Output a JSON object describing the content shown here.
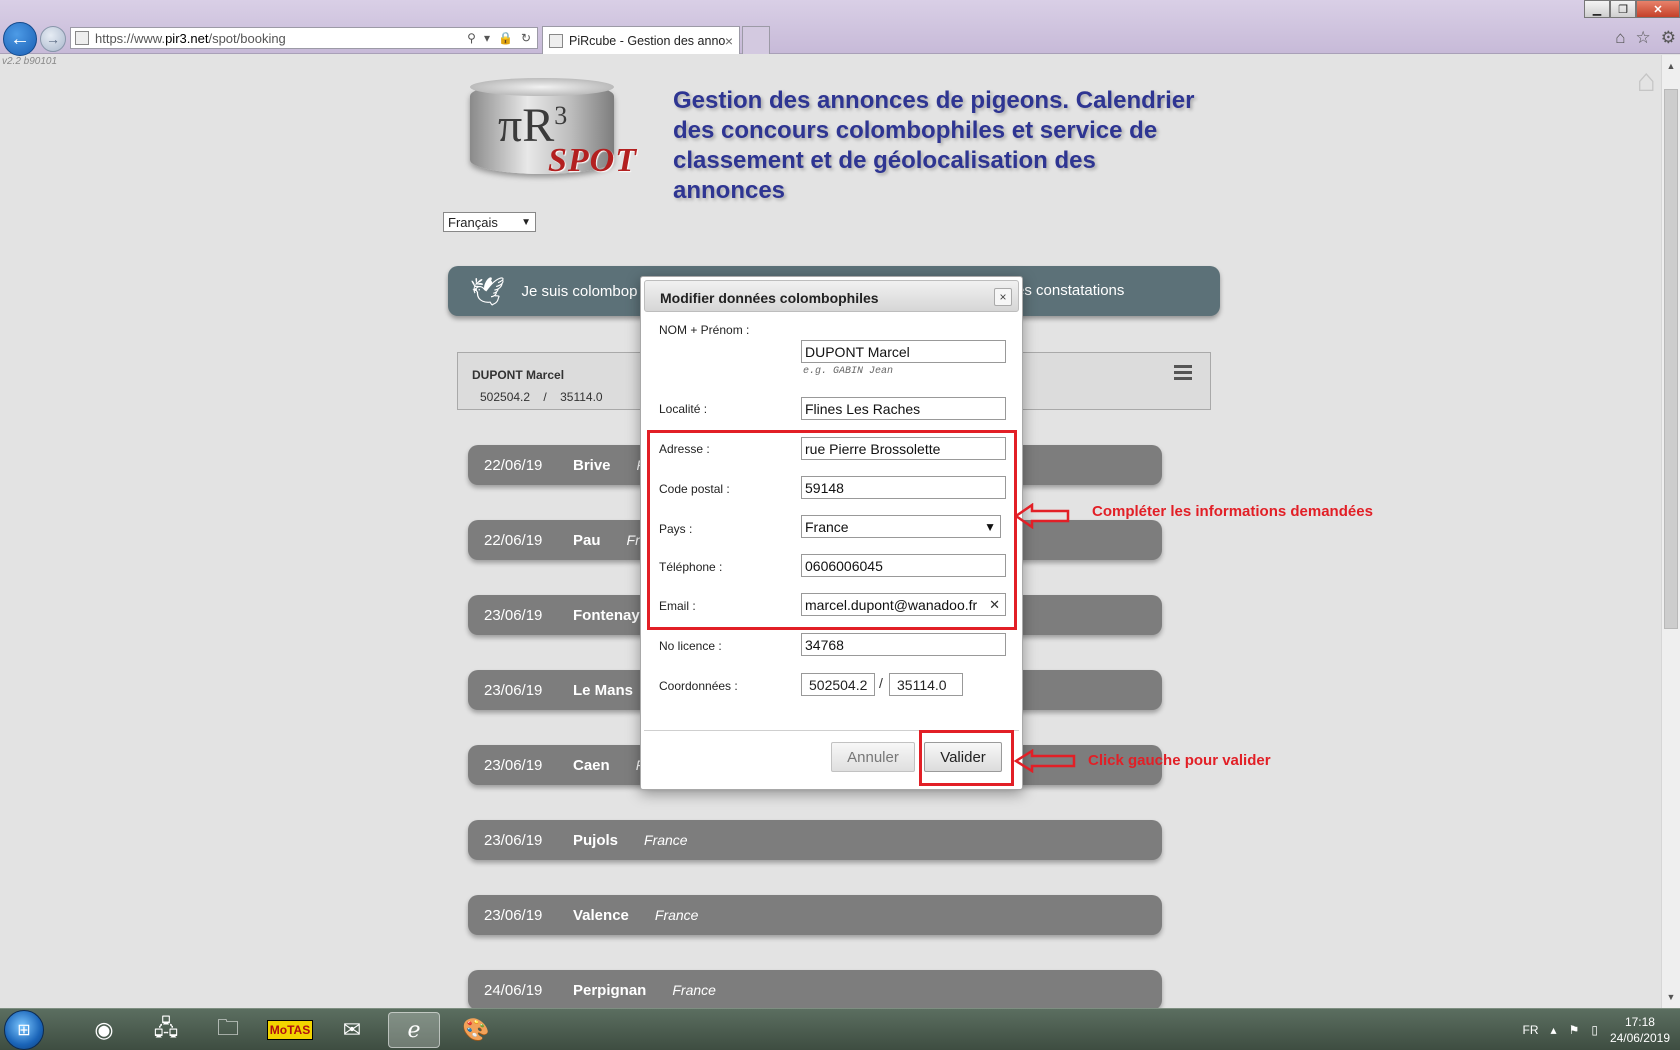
{
  "browser": {
    "url_prefix": "https://www.",
    "url_domain": "pir3.net",
    "url_path": "/spot/booking",
    "tab_title": "PiRcube - Gestion des anno...",
    "version": "v2.2 b90101"
  },
  "header": {
    "logo_pi": "πR",
    "logo_sup": "3",
    "logo_spot": "SPOT",
    "title": "Gestion des annonces de pigeons. Calendrier des concours colombophiles et service de classement et de géolocalisation des annonces",
    "language": "Français"
  },
  "banner": {
    "left_text": "Je suis colombop",
    "right_text": "es constatations"
  },
  "member": {
    "name": "DUPONT Marcel",
    "x": "502504.2",
    "sep": "/",
    "y": "35114.0"
  },
  "races": [
    {
      "date": "22/06/19",
      "city": "Brive",
      "country": "F"
    },
    {
      "date": "22/06/19",
      "city": "Pau",
      "country": "Fr"
    },
    {
      "date": "23/06/19",
      "city": "Fontenay-",
      "country": ""
    },
    {
      "date": "23/06/19",
      "city": "Le Mans",
      "country": ""
    },
    {
      "date": "23/06/19",
      "city": "Caen",
      "country": "F"
    },
    {
      "date": "23/06/19",
      "city": "Pujols",
      "country": "France"
    },
    {
      "date": "23/06/19",
      "city": "Valence",
      "country": "France"
    },
    {
      "date": "24/06/19",
      "city": "Perpignan",
      "country": "France"
    }
  ],
  "modal": {
    "title": "Modifier données colombophiles",
    "close": "×",
    "fields": {
      "name_label": "NOM + Prénom :",
      "name_value": "DUPONT Marcel",
      "name_hint": "e.g. GABIN Jean",
      "city_label": "Localité :",
      "city_value": "Flines Les Raches",
      "address_label": "Adresse :",
      "address_value": "rue Pierre Brossolette",
      "zip_label": "Code postal :",
      "zip_value": "59148",
      "country_label": "Pays :",
      "country_value": "France",
      "phone_label": "Téléphone :",
      "phone_value": "0606006045",
      "email_label": "Email :",
      "email_value": "marcel.dupont@wanadoo.fr",
      "license_label": "No licence :",
      "license_value": "34768",
      "coords_label": "Coordonnées :",
      "coord_x": "502504.2",
      "coord_sep": "/",
      "coord_y": "35114.0"
    },
    "cancel_label": "Annuler",
    "ok_label": "Valider"
  },
  "annotations": {
    "fill_info": "Compléter les informations demandées",
    "click_validate": "Click gauche pour valider",
    "color": "#e21f26"
  },
  "taskbar": {
    "language": "FR",
    "time": "17:18",
    "date": "24/06/2019"
  }
}
